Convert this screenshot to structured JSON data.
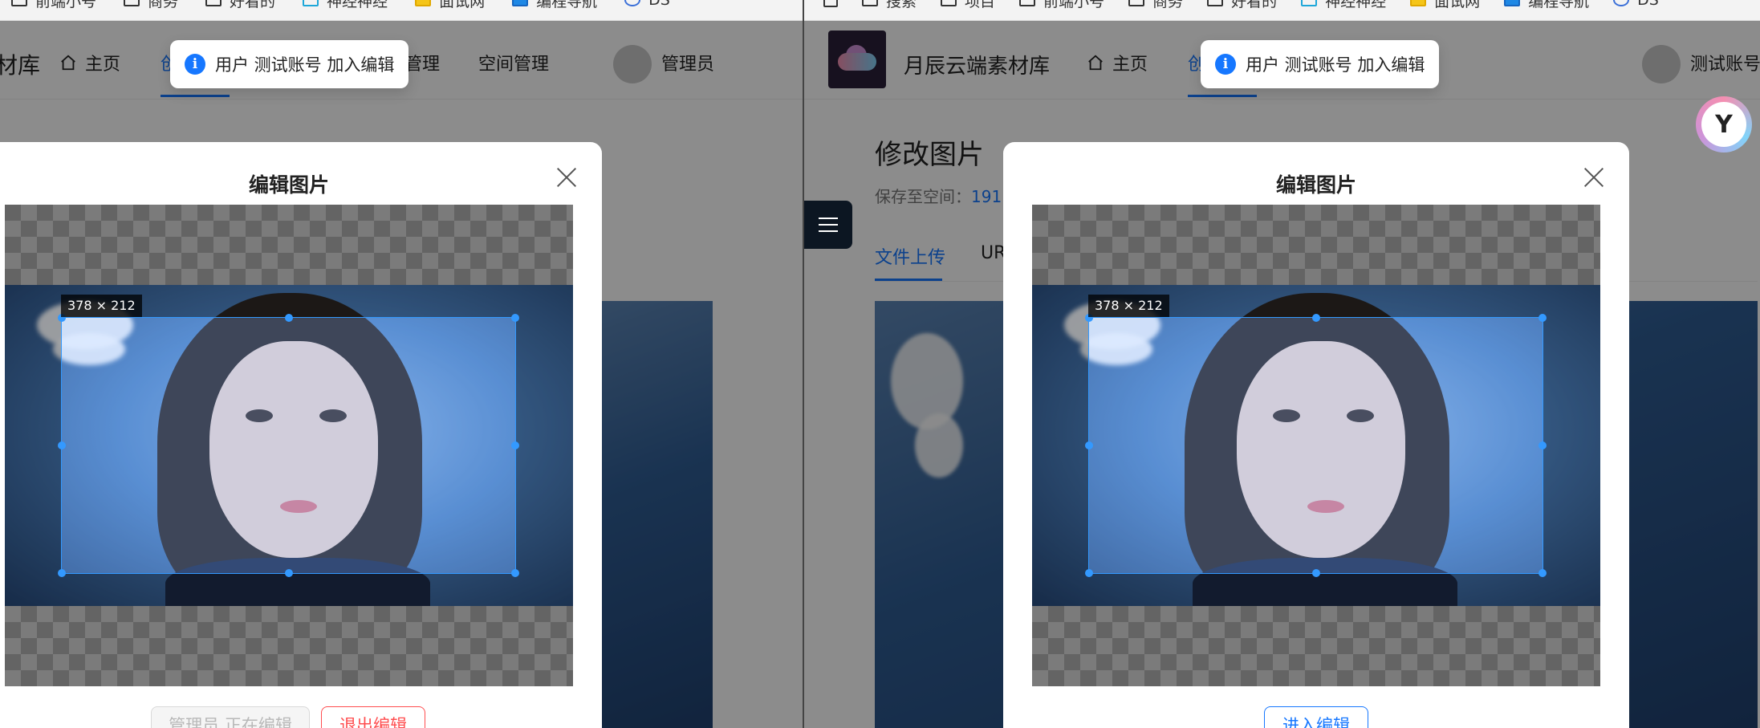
{
  "left": {
    "bookmarks": [
      "前端小号",
      "商务",
      "好看的",
      "神经神经",
      "面试网",
      "编程导航",
      "DS"
    ],
    "nav": {
      "brand_tail": "材库",
      "home": "主页",
      "item_hidden": "创",
      "manage": "管理",
      "space_manage": "空间管理",
      "username": "管理员"
    },
    "toast": {
      "text": "用户 测试账号 加入编辑",
      "icon": "info-icon"
    },
    "modal": {
      "title": "编辑图片",
      "crop_size": "378 × 212",
      "buttons": {
        "status": "管理员 正在编辑",
        "exit": "退出编辑"
      }
    }
  },
  "right": {
    "bookmarks": [
      "搜索",
      "项目",
      "前端小号",
      "商务",
      "好看的",
      "神经神经",
      "面试网",
      "编程导航",
      "DS"
    ],
    "nav": {
      "brand": "月辰云端素材库",
      "home": "主页",
      "item_hidden": "创",
      "username": "测试账号"
    },
    "page": {
      "title": "修改图片",
      "save_to_label": "保存至空间：",
      "save_to_value": "191",
      "tab_upload": "文件上传",
      "tab_url": "UR"
    },
    "toast": {
      "text": "用户 测试账号 加入编辑",
      "icon": "info-icon"
    },
    "modal": {
      "title": "编辑图片",
      "crop_size": "378 × 212",
      "buttons": {
        "enter": "进入编辑"
      }
    }
  },
  "colors": {
    "primary": "#1677ff",
    "danger": "#ff4d4f",
    "mask": "rgba(0,0,0,0.45)"
  }
}
